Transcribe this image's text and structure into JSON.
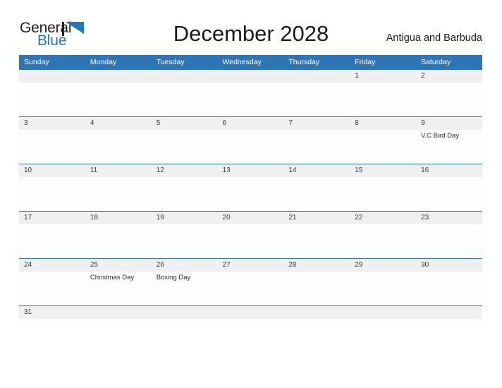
{
  "brand": {
    "name_part1": "General",
    "name_part2": "Blue",
    "color_dark": "#231f20",
    "color_blue": "#1b7ac2"
  },
  "header": {
    "title": "December 2028",
    "region": "Antigua and Barbuda"
  },
  "theme": {
    "header_blue": "#2e75b6",
    "row_line_blue": "#2e75b6",
    "day_band_gray": "#f0f0f0",
    "page_background": "#ffffff"
  },
  "calendar": {
    "weekdays": [
      "Sunday",
      "Monday",
      "Tuesday",
      "Wednesday",
      "Thursday",
      "Friday",
      "Saturday"
    ],
    "weeks": [
      {
        "days": [
          {
            "number": "",
            "events": []
          },
          {
            "number": "",
            "events": []
          },
          {
            "number": "",
            "events": []
          },
          {
            "number": "",
            "events": []
          },
          {
            "number": "",
            "events": []
          },
          {
            "number": "1",
            "events": []
          },
          {
            "number": "2",
            "events": []
          }
        ]
      },
      {
        "days": [
          {
            "number": "3",
            "events": []
          },
          {
            "number": "4",
            "events": []
          },
          {
            "number": "5",
            "events": []
          },
          {
            "number": "6",
            "events": []
          },
          {
            "number": "7",
            "events": []
          },
          {
            "number": "8",
            "events": []
          },
          {
            "number": "9",
            "events": [
              "V.C Bird Day"
            ]
          }
        ]
      },
      {
        "days": [
          {
            "number": "10",
            "events": []
          },
          {
            "number": "11",
            "events": []
          },
          {
            "number": "12",
            "events": []
          },
          {
            "number": "13",
            "events": []
          },
          {
            "number": "14",
            "events": []
          },
          {
            "number": "15",
            "events": []
          },
          {
            "number": "16",
            "events": []
          }
        ]
      },
      {
        "days": [
          {
            "number": "17",
            "events": []
          },
          {
            "number": "18",
            "events": []
          },
          {
            "number": "19",
            "events": []
          },
          {
            "number": "20",
            "events": []
          },
          {
            "number": "21",
            "events": []
          },
          {
            "number": "22",
            "events": []
          },
          {
            "number": "23",
            "events": []
          }
        ]
      },
      {
        "days": [
          {
            "number": "24",
            "events": []
          },
          {
            "number": "25",
            "events": [
              "Christmas Day"
            ]
          },
          {
            "number": "26",
            "events": [
              "Boxing Day"
            ]
          },
          {
            "number": "27",
            "events": []
          },
          {
            "number": "28",
            "events": []
          },
          {
            "number": "29",
            "events": []
          },
          {
            "number": "30",
            "events": []
          }
        ]
      },
      {
        "days": [
          {
            "number": "31",
            "events": []
          },
          {
            "number": "",
            "events": []
          },
          {
            "number": "",
            "events": []
          },
          {
            "number": "",
            "events": []
          },
          {
            "number": "",
            "events": []
          },
          {
            "number": "",
            "events": []
          },
          {
            "number": "",
            "events": []
          }
        ]
      }
    ]
  }
}
